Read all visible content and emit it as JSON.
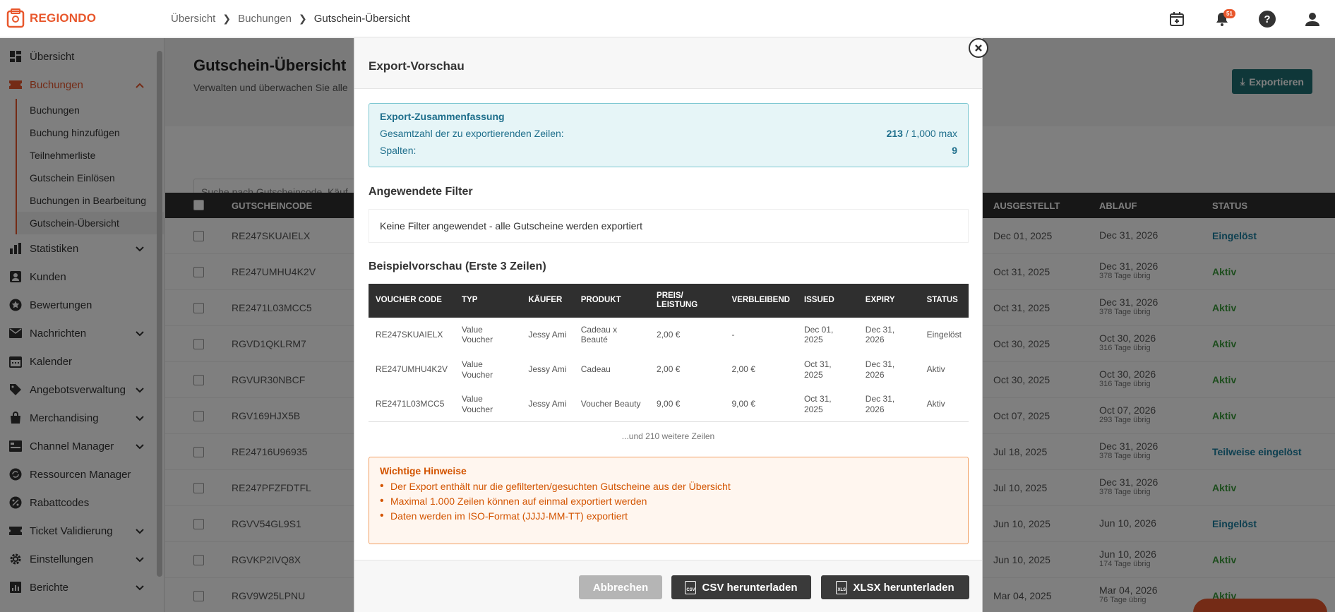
{
  "app": {
    "logo_text": "REGIONDO",
    "brand_color": "#e8572c"
  },
  "breadcrumb": [
    "Übersicht",
    "Buchungen",
    "Gutschein-Übersicht"
  ],
  "top_icons": {
    "notifications_count": "51"
  },
  "sidebar": {
    "items": [
      {
        "label": "Übersicht",
        "icon": "dashboard-icon"
      },
      {
        "label": "Buchungen",
        "icon": "ticket-icon",
        "active": true
      },
      {
        "label": "Statistiken",
        "icon": "chart-icon"
      },
      {
        "label": "Kunden",
        "icon": "person-icon"
      },
      {
        "label": "Bewertungen",
        "icon": "star-icon"
      },
      {
        "label": "Nachrichten",
        "icon": "mail-icon"
      },
      {
        "label": "Kalender",
        "icon": "calendar-icon"
      },
      {
        "label": "Angebotsverwaltung",
        "icon": "tag-icon"
      },
      {
        "label": "Merchandising",
        "icon": "bag-icon"
      },
      {
        "label": "Channel Manager",
        "icon": "channel-icon"
      },
      {
        "label": "Ressourcen Manager",
        "icon": "resource-icon"
      },
      {
        "label": "Rabattcodes",
        "icon": "percent-icon"
      },
      {
        "label": "Ticket Validierung",
        "icon": "ticket-check-icon"
      },
      {
        "label": "Einstellungen",
        "icon": "gear-icon"
      },
      {
        "label": "Berichte",
        "icon": "report-icon"
      }
    ],
    "sub_items": [
      "Buchungen",
      "Buchung hinzufügen",
      "Teilnehmerliste",
      "Gutschein Einlösen",
      "Buchungen in Bearbeitung",
      "Gutschein-Übersicht"
    ]
  },
  "page": {
    "title": "Gutschein-Übersicht",
    "subtitle": "Verwalten und überwachen Sie alle",
    "export_label": "Exportieren",
    "search_placeholder": "Suche nach Gutscheincode, Käufer"
  },
  "table": {
    "headers": {
      "code": "GUTSCHEINCODE",
      "issued": "AUSGESTELLT",
      "expiry": "ABLAUF",
      "status": "STATUS"
    },
    "rows": [
      {
        "code": "RE247SKUAIELX",
        "issued": "Dec 01, 2025",
        "expiry": "Dec 31, 2026",
        "remaining": "",
        "status": "Eingelöst"
      },
      {
        "code": "RE247UMHU4K2V",
        "issued": "Oct 31, 2025",
        "expiry": "Dec 31, 2026",
        "remaining": "378 Tage übrig",
        "status": "Aktiv"
      },
      {
        "code": "RE2471L03MCC5",
        "issued": "Oct 31, 2025",
        "expiry": "Dec 31, 2026",
        "remaining": "378 Tage übrig",
        "status": "Aktiv"
      },
      {
        "code": "RGVD1QKLRM7",
        "issued": "Oct 30, 2025",
        "expiry": "Oct 30, 2026",
        "remaining": "316 Tage übrig",
        "status": "Aktiv"
      },
      {
        "code": "RGVUR30NBCF",
        "issued": "Oct 30, 2025",
        "expiry": "Oct 30, 2026",
        "remaining": "316 Tage übrig",
        "status": "Aktiv"
      },
      {
        "code": "RGV169HJX5B",
        "issued": "Oct 07, 2025",
        "expiry": "Oct 07, 2026",
        "remaining": "293 Tage übrig",
        "status": "Aktiv"
      },
      {
        "code": "RE24716U96935",
        "issued": "Jul 18, 2025",
        "expiry": "Dec 31, 2026",
        "remaining": "378 Tage übrig",
        "status": "Teilweise eingelöst"
      },
      {
        "code": "RE247PFZFDTFL",
        "issued": "Jul 10, 2025",
        "expiry": "Dec 31, 2026",
        "remaining": "378 Tage übrig",
        "status": "Aktiv"
      },
      {
        "code": "RGVV54GL9S1",
        "issued": "Jun 10, 2025",
        "expiry": "Jun 10, 2026",
        "remaining": "",
        "status": "Eingelöst"
      },
      {
        "code": "RGVKP2IVQ8X",
        "issued": "Jun 10, 2025",
        "expiry": "Jun 10, 2026",
        "remaining": "174 Tage übrig",
        "status": "Aktiv"
      },
      {
        "code": "RGV9W25LPNU",
        "issued": "Mar 04, 2025",
        "expiry": "Mar 04, 2026",
        "remaining": "76 Tage übrig",
        "status": "Aktiv"
      }
    ]
  },
  "modal": {
    "title": "Export-Vorschau",
    "summary": {
      "title": "Export-Zusammenfassung",
      "rows_label": "Gesamtzahl der zu exportierenden Zeilen:",
      "rows_value": "213",
      "rows_max": "/ 1,000 max",
      "cols_label": "Spalten:",
      "cols_value": "9"
    },
    "filters_title": "Angewendete Filter",
    "filters_text": "Keine Filter angewendet - alle Gutscheine werden exportiert",
    "preview_title": "Beispielvorschau (Erste 3 Zeilen)",
    "preview_headers": [
      "VOUCHER CODE",
      "TYP",
      "KÄUFER",
      "PRODUKT",
      "PREIS/ LEISTUNG",
      "VERBLEIBEND",
      "ISSUED",
      "EXPIRY",
      "STATUS"
    ],
    "preview_rows": [
      [
        "RE247SKUAIELX",
        "Value Voucher",
        "Jessy Ami",
        "Cadeau x Beauté",
        "2,00 €",
        "-",
        "Dec 01, 2025",
        "Dec 31, 2026",
        "Eingelöst"
      ],
      [
        "RE247UMHU4K2V",
        "Value Voucher",
        "Jessy Ami",
        "Cadeau",
        "2,00 €",
        "2,00 €",
        "Oct 31, 2025",
        "Dec 31, 2026",
        "Aktiv"
      ],
      [
        "RE2471L03MCC5",
        "Value Voucher",
        "Jessy Ami",
        "Voucher Beauty",
        "9,00 €",
        "9,00 €",
        "Oct 31, 2025",
        "Dec 31, 2026",
        "Aktiv"
      ]
    ],
    "more_rows": "...und 210 weitere Zeilen",
    "notes_title": "Wichtige Hinweise",
    "notes": [
      "Der Export enthält nur die gefilterten/gesuchten Gutscheine aus der Übersicht",
      "Maximal 1.000 Zeilen können auf einmal exportiert werden",
      "Daten werden im ISO-Format (JJJJ-MM-TT) exportiert"
    ],
    "cancel_label": "Abbrechen",
    "csv_label": "CSV herunterladen",
    "xlsx_label": "XLSX herunterladen",
    "csv_icon_text": "CSV",
    "xlsx_icon_text": "XLS"
  }
}
